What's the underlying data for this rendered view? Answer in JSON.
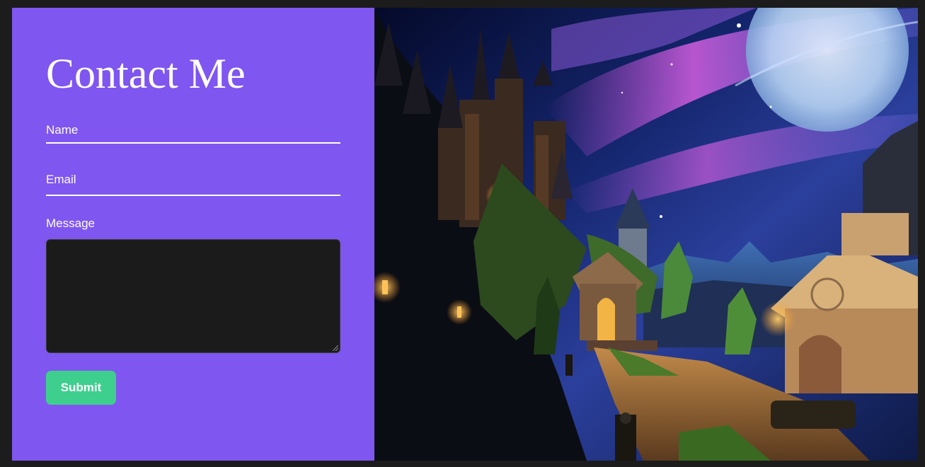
{
  "form": {
    "title": "Contact Me",
    "name_label": "Name",
    "email_label": "Email",
    "message_label": "Message",
    "name_value": "",
    "email_value": "",
    "message_value": "",
    "submit_label": "Submit"
  },
  "colors": {
    "panel_background": "#7f56ef",
    "submit_button": "#3ecf8e",
    "textarea_background": "#1b1b1b",
    "page_background": "#1c1c1c"
  },
  "image": {
    "icon": "fantasy-castle-night-illustration"
  }
}
